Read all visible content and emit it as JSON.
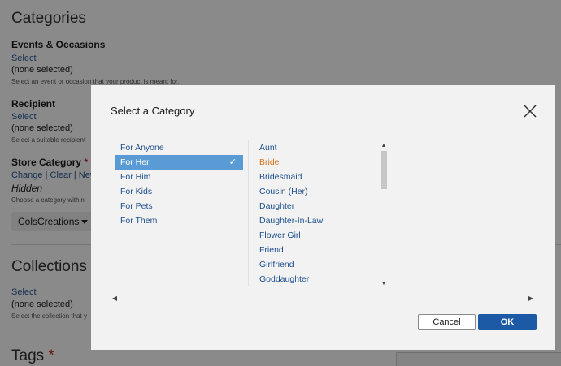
{
  "background": {
    "categories_heading": "Categories",
    "events": {
      "label": "Events & Occasions",
      "link": "Select",
      "value": "(none selected)",
      "hint": "Select an event or occasion that your product is meant for."
    },
    "recipient": {
      "label": "Recipient",
      "link": "Select",
      "value": "(none selected)",
      "hint": "Select a suitable recipient"
    },
    "store_category": {
      "label": "Store Category",
      "required_mark": "*",
      "links": "Change | Clear | New",
      "value": "Hidden",
      "hint": "Choose a category within",
      "dropdown_value": "ColsCreations"
    },
    "collections": {
      "heading": "Collections",
      "link": "Select",
      "value": "(none selected)",
      "hint": "Select the collection that y"
    },
    "tags": {
      "heading": "Tags",
      "required_mark": "*"
    }
  },
  "modal": {
    "title": "Select a Category",
    "close_icon": "close-icon",
    "left_list": [
      {
        "label": "For Anyone",
        "selected": false
      },
      {
        "label": "For Her",
        "selected": true
      },
      {
        "label": "For Him",
        "selected": false
      },
      {
        "label": "For Kids",
        "selected": false
      },
      {
        "label": "For Pets",
        "selected": false
      },
      {
        "label": "For Them",
        "selected": false
      }
    ],
    "selected_check": "✓",
    "right_list": [
      {
        "label": "Aunt"
      },
      {
        "label": "Bride",
        "highlight": true
      },
      {
        "label": "Bridesmaid"
      },
      {
        "label": "Cousin (Her)"
      },
      {
        "label": "Daughter"
      },
      {
        "label": "Daughter-In-Law"
      },
      {
        "label": "Flower Girl"
      },
      {
        "label": "Friend"
      },
      {
        "label": "Girlfriend"
      },
      {
        "label": "Goddaughter"
      }
    ],
    "buttons": {
      "cancel": "Cancel",
      "ok": "OK"
    },
    "colors": {
      "selected_bg": "#5b9bd5",
      "highlight": "#d9701b",
      "primary": "#1d5aa6",
      "link": "#1e4f8c"
    }
  }
}
